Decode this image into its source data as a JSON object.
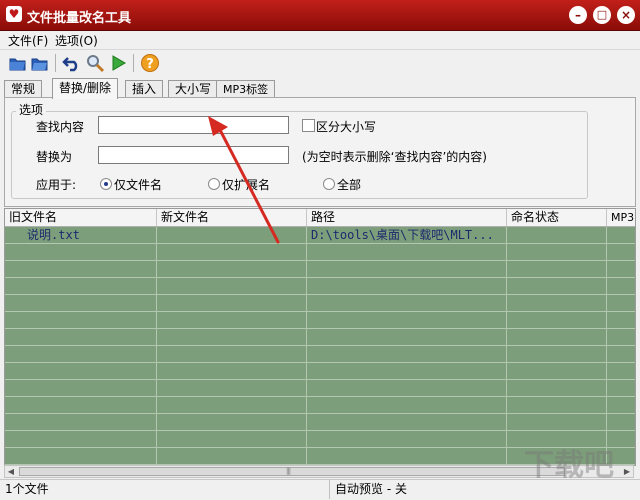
{
  "window": {
    "title": "文件批量改名工具",
    "minimize": "–",
    "maximize": "□",
    "close": "×"
  },
  "menu": {
    "file": "文件(F)",
    "options": "选项(O)"
  },
  "toolbar": {
    "icons": [
      "open-folder-icon",
      "save-folder-icon",
      "undo-icon",
      "search-icon",
      "run-icon",
      "help-icon"
    ]
  },
  "tabs": [
    "常规",
    "替换/删除",
    "插入",
    "大小写",
    "MP3标签"
  ],
  "options": {
    "group_title": "选项",
    "find_label": "查找内容",
    "find_value": "",
    "case_label": "区分大小写",
    "replace_label": "替换为",
    "replace_value": "",
    "replace_hint": "(为空时表示删除‘查找内容’的内容)",
    "apply_label": "应用于:",
    "apply_options": [
      "仅文件名",
      "仅扩展名",
      "全部"
    ],
    "apply_selected": "仅文件名"
  },
  "table": {
    "columns": [
      "旧文件名",
      "新文件名",
      "路径",
      "命名状态",
      "MP3"
    ],
    "rows": [
      {
        "old_name": "说明.txt",
        "new_name": "",
        "path": "D:\\tools\\桌面\\下载吧\\MLT...",
        "status": ""
      }
    ]
  },
  "status": {
    "count": "1个文件",
    "preview": "自动预览 - 关"
  },
  "colors": {
    "title_bar": "#b01a14",
    "list_bg": "#7d9e7a",
    "annotation_arrow": "#d42a22"
  }
}
